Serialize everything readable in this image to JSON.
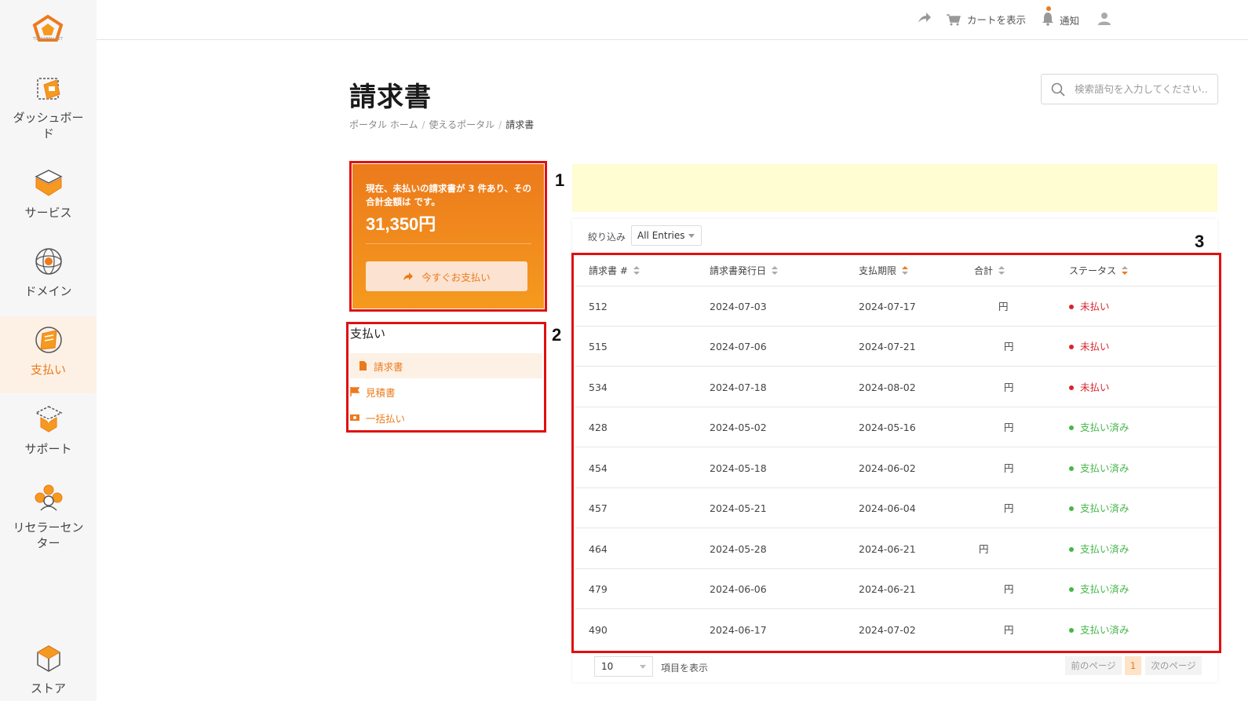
{
  "brand": {
    "logo_text": "TSUKAERU.NET",
    "accent": "#ec7a1c"
  },
  "sidebar": {
    "items": [
      {
        "label": "ダッシュボード",
        "icon": "dashboard-icon"
      },
      {
        "label": "サービス",
        "icon": "box-icon"
      },
      {
        "label": "ドメイン",
        "icon": "globe-icon"
      },
      {
        "label": "支払い",
        "icon": "payment-icon",
        "active": true
      },
      {
        "label": "サポート",
        "icon": "support-icon"
      },
      {
        "label": "リセラーセンター",
        "icon": "reseller-icon"
      },
      {
        "label": "ストア",
        "icon": "store-icon"
      }
    ]
  },
  "topbar": {
    "share_icon": "share-icon",
    "cart_label": "カートを表示",
    "notify_label": "通知",
    "user_icon": "user-icon"
  },
  "page": {
    "title": "請求書",
    "breadcrumb": [
      "ポータル ホーム",
      "使えるポータル",
      "請求書"
    ],
    "search_placeholder": "検索語句を入力してください..."
  },
  "summary": {
    "text": "現在、未払いの請求書が 3 件あり、その合計金額は です。",
    "amount": "31,350円",
    "pay_button": "今すぐお支払い"
  },
  "side_menu": {
    "title": "支払い",
    "items": [
      {
        "label": "請求書",
        "icon": "document-icon",
        "active": true
      },
      {
        "label": "見積書",
        "icon": "flag-icon"
      },
      {
        "label": "一括払い",
        "icon": "money-icon"
      }
    ]
  },
  "annotations": [
    "1",
    "2",
    "3"
  ],
  "table": {
    "filter_label": "絞り込み",
    "filter_value": "All Entries",
    "headers": [
      "請求書 #",
      "請求書発行日",
      "支払期限",
      "合計",
      "ステータス"
    ],
    "rows": [
      {
        "id": "512",
        "issued": "2024-07-03",
        "due": "2024-07-17",
        "total": "円",
        "status": "未払い",
        "state": "unpaid"
      },
      {
        "id": "515",
        "issued": "2024-07-06",
        "due": "2024-07-21",
        "total": "円",
        "status": "未払い",
        "state": "unpaid"
      },
      {
        "id": "534",
        "issued": "2024-07-18",
        "due": "2024-08-02",
        "total": "円",
        "status": "未払い",
        "state": "unpaid"
      },
      {
        "id": "428",
        "issued": "2024-05-02",
        "due": "2024-05-16",
        "total": "円",
        "status": "支払い済み",
        "state": "paid"
      },
      {
        "id": "454",
        "issued": "2024-05-18",
        "due": "2024-06-02",
        "total": "円",
        "status": "支払い済み",
        "state": "paid"
      },
      {
        "id": "457",
        "issued": "2024-05-21",
        "due": "2024-06-04",
        "total": "円",
        "status": "支払い済み",
        "state": "paid"
      },
      {
        "id": "464",
        "issued": "2024-05-28",
        "due": "2024-06-21",
        "total": "円",
        "status": "支払い済み",
        "state": "paid"
      },
      {
        "id": "479",
        "issued": "2024-06-06",
        "due": "2024-06-21",
        "total": "円",
        "status": "支払い済み",
        "state": "paid"
      },
      {
        "id": "490",
        "issued": "2024-06-17",
        "due": "2024-07-02",
        "total": "円",
        "status": "支払い済み",
        "state": "paid"
      }
    ],
    "page_size": "10",
    "page_size_label": "項目を表示",
    "prev_label": "前のページ",
    "current_page": "1",
    "next_label": "次のページ"
  },
  "colors": {
    "unpaid": "#d9232e",
    "paid": "#45b649",
    "accent": "#ec7a1c",
    "banner": "#fffdd1"
  }
}
